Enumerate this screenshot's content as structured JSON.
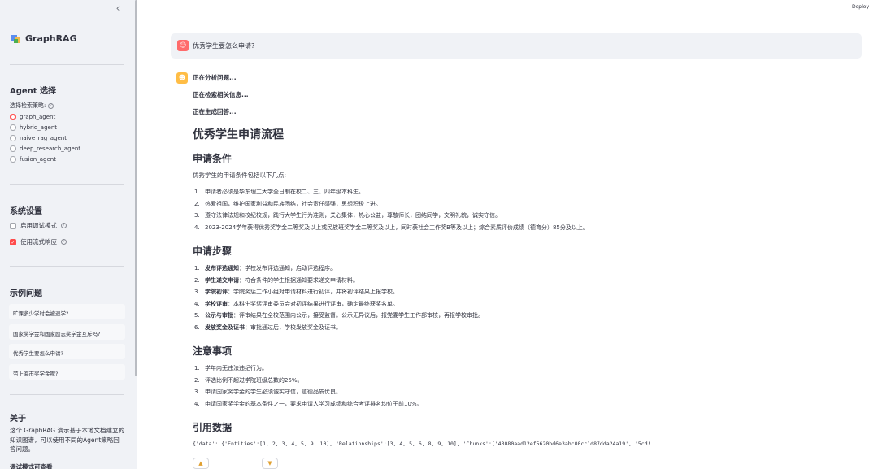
{
  "header": {
    "deploy_label": "Deploy"
  },
  "sidebar": {
    "collapse_icon": "chevron-left-icon",
    "brand": "GraphRAG",
    "agent_section": {
      "title": "Agent 选择",
      "label": "选择检索策略:",
      "options": [
        "graph_agent",
        "hybrid_agent",
        "naive_rag_agent",
        "deep_research_agent",
        "fusion_agent"
      ],
      "selected": "graph_agent"
    },
    "settings": {
      "title": "系统设置",
      "debug_label": "启用调试模式",
      "debug_checked": false,
      "stream_label": "使用流式响应",
      "stream_checked": true
    },
    "examples": {
      "title": "示例问题",
      "items": [
        "旷课多少学时会被退学?",
        "国家奖学金和国家励志奖学金互斥吗?",
        "优秀学生要怎么申请?",
        "劳上海市奖学金呢?"
      ]
    },
    "about": {
      "title": "关于",
      "text": "这个 GraphRAG 演示基于本地文档建立的知识图谱，可以使用不同的Agent策略回答问题。",
      "cut_heading": "调试模式可查看"
    }
  },
  "chat": {
    "user_question": "优秀学生要怎么申请?",
    "statuses": [
      "正在分析问题...",
      "正在检索相关信息...",
      "正在生成回答..."
    ],
    "answer": {
      "title": "优秀学生申请流程",
      "conditions": {
        "heading": "申请条件",
        "intro": "优秀学生的申请条件包括以下几点:",
        "items": [
          "申请者必须是华东理工大学全日制在校二、三、四年级本科生。",
          "热爱祖国，维护国家利益和民族团结，社会责任感强，思想积极上进。",
          "遵守法律法规和校纪校规，践行大学生行为准则，关心集体，热心公益，尊敬师长，团结同学，文明礼貌，诚实守信。",
          "2023-2024学年获得优秀奖学金二等奖及以上或民族班奖学金二等奖及以上，同时获社会工作奖B等及以上；综合素质评价成绩（德育分）85分及以上。"
        ]
      },
      "steps": {
        "heading": "申请步骤",
        "items": [
          {
            "bold": "发布评选通知",
            "text": "：学校发布评选通知，启动评选程序。"
          },
          {
            "bold": "学生递交申请",
            "text": "：符合条件的学生根据通知要求递交申请材料。"
          },
          {
            "bold": "学院初评",
            "text": "：学院奖惩工作小组对申请材料进行初评，并将初评结果上报学校。"
          },
          {
            "bold": "学校评审",
            "text": "：本科生奖惩评审委员会对初评结果进行评审，确定最终获奖名单。"
          },
          {
            "bold": "公示与审批",
            "text": "：评审结果在全校范围内公示，接受监督。公示无异议后，报党委学生工作部审核，再报学校审批。"
          },
          {
            "bold": "发放奖金及证书",
            "text": "：审批通过后，学校发放奖金及证书。"
          }
        ]
      },
      "notes": {
        "heading": "注意事项",
        "items": [
          "学年内无违法违纪行为。",
          "评选比例不超过学院班级总数的25%。",
          "申请国家奖学金的学生必须诚实守信，道德品质优良。",
          "申请国家奖学金的基本条件之一，要求申请人学习成绩和综合考评排名均位于前10%。"
        ]
      },
      "refs": {
        "heading": "引用数据",
        "data": "{'data': {'Entities':[1, 2, 3, 4, 5, 9, 10], 'Relationships':[3, 4, 5, 6, 8, 9, 10], 'Chunks':['43080aad12ef5620bd6e3abc00cc1d87dda24a19', '5cd!"
      }
    },
    "feedback": {
      "up_icon": "thumbs-up-icon",
      "down_icon": "thumbs-down-icon"
    }
  },
  "colors": {
    "accent": "#ff4b4b",
    "sidebar_bg": "#f0f2f6",
    "user_avatar": "#ff6b6b",
    "bot_avatar": "#ffbd45"
  }
}
